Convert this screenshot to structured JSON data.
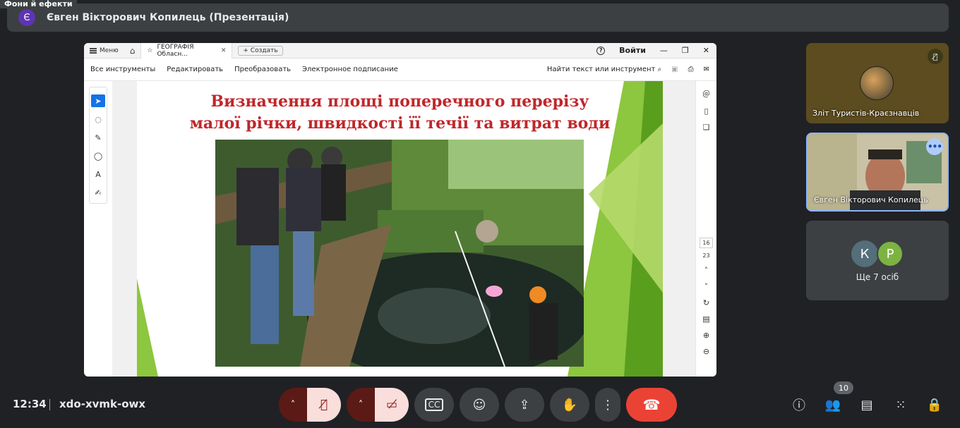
{
  "effects_tag": "Фони й ефекти",
  "presenter": {
    "initial": "Є",
    "title": "Євген Вікторович Копилець (Презентація)"
  },
  "viewer": {
    "menu_label": "Меню",
    "tab_title": "ГЕОГРАФІЯ Обласн...",
    "create_label": "Создать",
    "login_label": "Войти",
    "toolbar": {
      "all_tools": "Все инструменты",
      "edit": "Редактировать",
      "convert": "Преобразовать",
      "esign": "Электронное подписание",
      "find": "Найти текст или инструмент"
    },
    "page_current": "16",
    "page_total": "23"
  },
  "slide": {
    "title_line1": "Визначення площі поперечного перерізу",
    "title_line2": "малої річки, швидкості її течії та витрат води"
  },
  "participants": [
    {
      "name": "Зліт Туристів-Краєзнавців",
      "muted": true
    },
    {
      "name": "Євген Вікторович Копилець"
    },
    {
      "avatars": [
        "К",
        "Р"
      ],
      "more_label": "Ще 7 осіб"
    }
  ],
  "bottom": {
    "time": "12:34",
    "meeting_code": "xdo-xvmk-owx",
    "people_count": "10"
  },
  "colors": {
    "slide_title": "#c0262a",
    "hangup": "#ea4335",
    "muted_bg": "#f9dedc",
    "accent": "#8ab4f8"
  }
}
